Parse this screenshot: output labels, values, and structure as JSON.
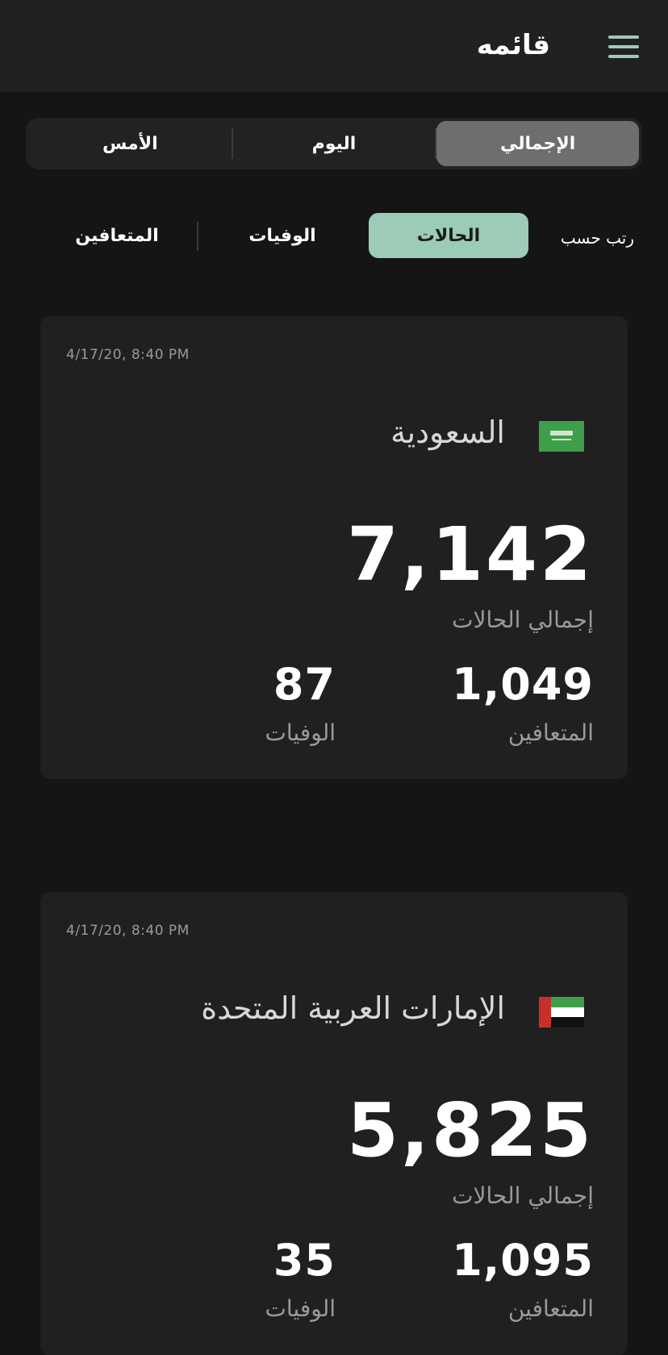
{
  "header": {
    "title": "قائمه",
    "menu_icon": "hamburger-menu-icon"
  },
  "period_tabs": [
    {
      "label": "الإجمالي",
      "active": true
    },
    {
      "label": "اليوم",
      "active": false
    },
    {
      "label": "الأمس",
      "active": false
    }
  ],
  "sort": {
    "label": "رتب حسب",
    "options": [
      {
        "label": "الحالات",
        "active": true
      },
      {
        "label": "الوفيات",
        "active": false
      },
      {
        "label": "المتعافين",
        "active": false
      }
    ]
  },
  "colors": {
    "accent": "#9ccbb8",
    "background": "#151515",
    "card": "#202020",
    "header": "#212121"
  },
  "cards": [
    {
      "timestamp": "4/17/20, 8:40 PM",
      "country": "السعودية",
      "flag_icon": "saudi-arabia-flag-icon",
      "total_cases": "7,142",
      "total_cases_label": "إجمالي الحالات",
      "recovered": "1,049",
      "recovered_label": "المتعافين",
      "deaths": "87",
      "deaths_label": "الوفيات"
    },
    {
      "timestamp": "4/17/20, 8:40 PM",
      "country": "الإمارات العربية المتحدة",
      "flag_icon": "uae-flag-icon",
      "total_cases": "5,825",
      "total_cases_label": "إجمالي الحالات",
      "recovered": "1,095",
      "recovered_label": "المتعافين",
      "deaths": "35",
      "deaths_label": "الوفيات"
    }
  ]
}
